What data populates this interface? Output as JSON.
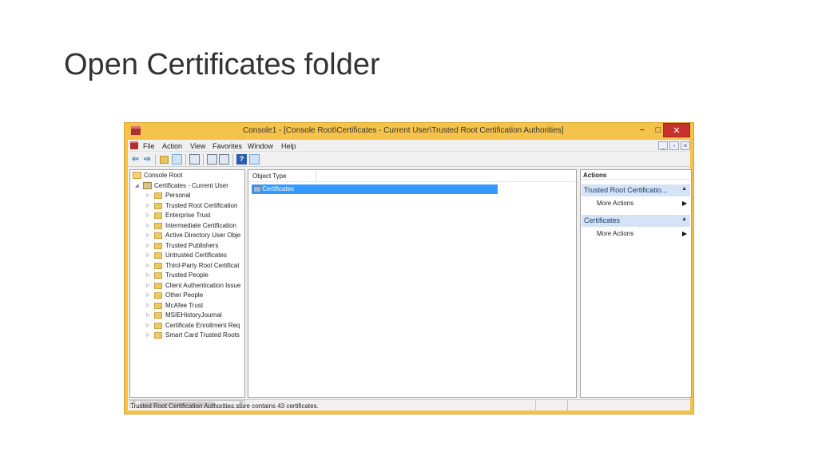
{
  "slide": {
    "title_prefix": "Open",
    "title_bold": "Certificates",
    "title_suffix": "folder"
  },
  "window": {
    "title": "Console1 - [Console Root\\Certificates - Current User\\Trusted Root Certification Authorities]",
    "min_glyph": "−",
    "max_glyph": "□",
    "close_glyph": "✕"
  },
  "menubar": {
    "items": [
      "File",
      "Action",
      "View",
      "Favorites",
      "Window",
      "Help"
    ],
    "mdi_controls": [
      "_",
      "▫",
      "×"
    ]
  },
  "toolbar": {
    "back": "⇦",
    "forward": "⇨",
    "help": "?"
  },
  "tree": {
    "root": "Console Root",
    "store": "Certificates - Current User",
    "items": [
      "Personal",
      "Trusted Root Certification",
      "Enterprise Trust",
      "Intermediate Certification",
      "Active Directory User Obje",
      "Trusted Publishers",
      "Untrusted Certificates",
      "Third-Party Root Certificat",
      "Trusted People",
      "Client Authentication Issue",
      "Other People",
      "McAfee Trust",
      "MSIEHistoryJournal",
      "Certificate Enrollment Req",
      "Smart Card Trusted Roots"
    ],
    "scroll_left": "<",
    "scroll_right": ">"
  },
  "center": {
    "column_header": "Object Type",
    "rows": [
      "Certificates"
    ]
  },
  "actions": {
    "header": "Actions",
    "sections": [
      {
        "title": "Trusted Root Certificatio...",
        "item": "More Actions"
      },
      {
        "title": "Certificates",
        "item": "More Actions"
      }
    ],
    "caret": "▲",
    "arrow": "▶"
  },
  "status": {
    "text": "Trusted Root Certification Authorities store contains 43 certificates."
  }
}
